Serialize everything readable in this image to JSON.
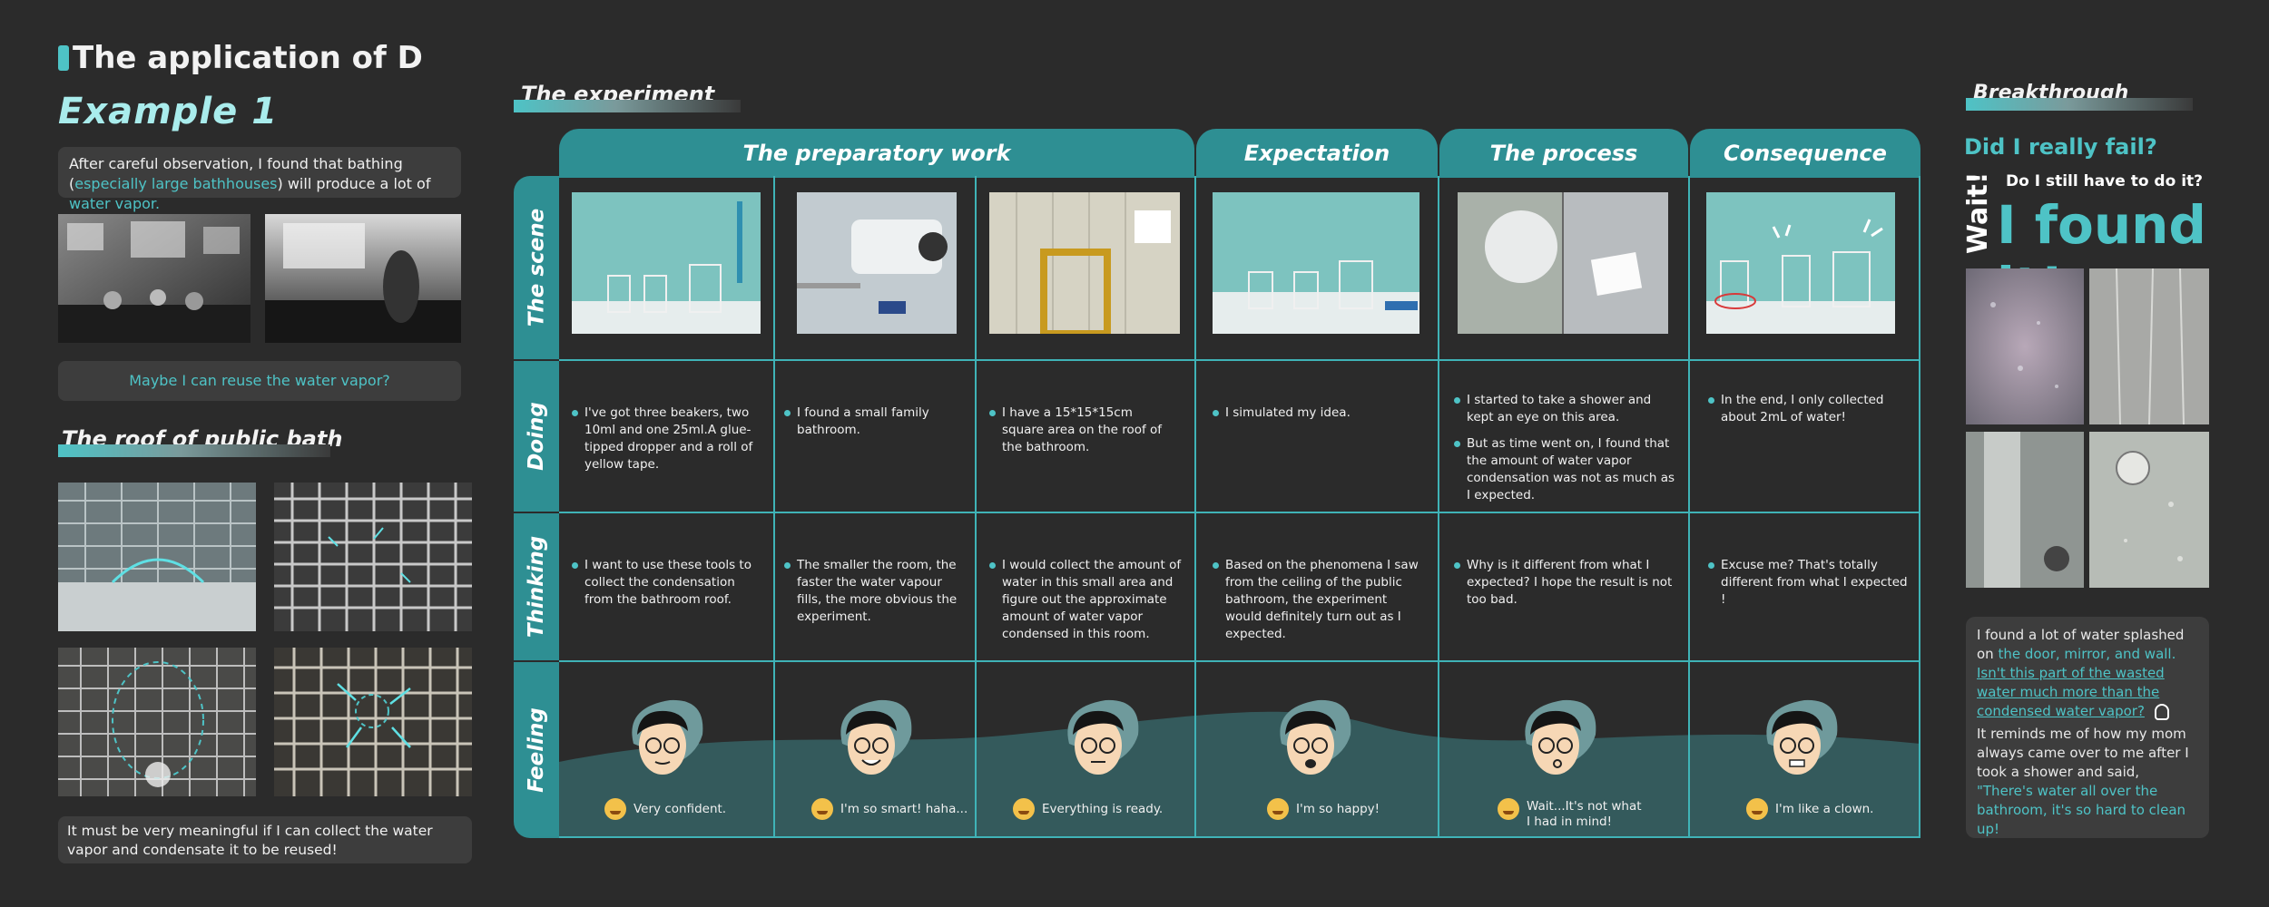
{
  "header": {
    "title": "The application of D",
    "example_title": "Example 1"
  },
  "left": {
    "intro_prefix": "After careful observation, I found that bathing (",
    "intro_highlight": "especially large bathhouses",
    "intro_middle": ") will produce a lot of ",
    "intro_highlight2": "water vapor",
    "intro_suffix": ".",
    "question": "Maybe I can reuse the water vapor?",
    "roof_title": "The roof of public bath",
    "conclusion": "It must be very meaningful if I can collect the water vapor and condensate it to be reused!"
  },
  "experiment": {
    "title": "The experiment",
    "columns": [
      "The preparatory work",
      "Expectation",
      "The process",
      "Consequence"
    ],
    "rows": [
      "The scene",
      "Doing",
      "Thinking",
      "Feeling"
    ],
    "doing": [
      [
        "I've got three beakers, two 10ml and one 25ml.A glue-tipped dropper and a roll of yellow tape."
      ],
      [
        "I found a small family bathroom."
      ],
      [
        "I have a 15*15*15cm square area on the roof of the bathroom."
      ],
      [
        "I simulated my idea."
      ],
      [
        "I started to take a shower and kept an eye on this area.",
        "But as time went on, I found that the amount of water vapor condensation was not as much as I expected."
      ],
      [
        "In the end, I only collected about 2mL of water!"
      ]
    ],
    "thinking": [
      "I want to use these tools to collect the condensation from the bathroom roof.",
      "The smaller the room, the faster the water vapour fills, the more obvious the experiment.",
      "I would collect the amount of water in this small area and figure out the approximate amount of water vapor condensed in this room.",
      "Based on the phenomena I saw from the ceiling of the public bathroom, the experiment would definitely turn out as I expected.",
      "Why is it different from what I expected? I hope the result is not too bad.",
      "Excuse me?  That's totally different from what I expected !"
    ],
    "feeling": [
      "Very confident.",
      "I'm so smart! haha...",
      "Everything is ready.",
      "I'm so happy!",
      "Wait...It's not what I had in mind!",
      "I'm like a clown."
    ]
  },
  "breakthrough": {
    "title": "Breakthrough",
    "did_fail": "Did I really fail?",
    "wait": "Wait!",
    "still": "Do I still have to do it?",
    "found": "I found it!",
    "note_prefix": "I found a lot of water splashed on ",
    "note_highlight": "the door, mirror, and wall.",
    "note_underlined": "Isn't this part of the wasted water much more than the condensed water vapor?",
    "note2_prefix": "It reminds me of how my mom always came over to me after I took a shower and said, ",
    "note2_highlight": "\"There's water all over the bathroom, it's so hard to clean up!"
  },
  "colors": {
    "background": "#2b2b2b",
    "accent": "#4ec3c6",
    "table_header": "#2e8f93",
    "panel": "#3d3d3d"
  }
}
